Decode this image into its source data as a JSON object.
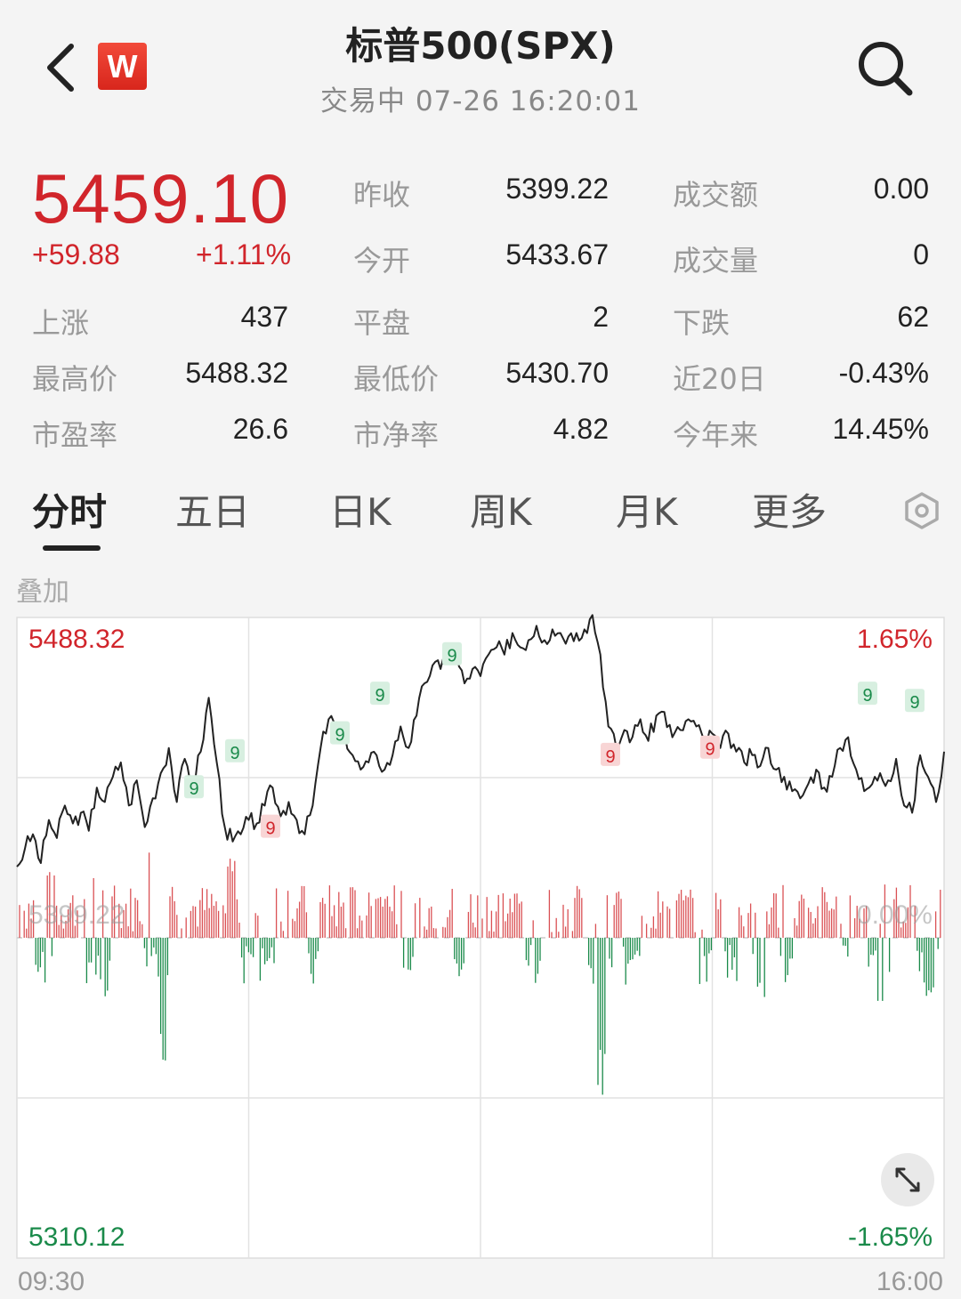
{
  "header": {
    "title": "标普500(SPX)",
    "status": "交易中 07-26 16:20:01",
    "logo_letter": "W",
    "back_icon": "chevron-left-icon",
    "search_icon": "search-icon"
  },
  "quote": {
    "price": "5459.10",
    "change": "+59.88",
    "change_pct": "+1.11%",
    "up_color": "#d1252b",
    "down_color": "#1a8a4a"
  },
  "stats": {
    "prev_close_label": "昨收",
    "prev_close": "5399.22",
    "open_label": "今开",
    "open": "5433.67",
    "turnover_label": "成交额",
    "turnover": "0.00",
    "volume_label": "成交量",
    "volume": "0",
    "advance_label": "上涨",
    "advance": "437",
    "flat_label": "平盘",
    "flat": "2",
    "decline_label": "下跌",
    "decline": "62",
    "high_label": "最高价",
    "high": "5488.32",
    "low_label": "最低价",
    "low": "5430.70",
    "d20_label": "近20日",
    "d20": "-0.43%",
    "pe_label": "市盈率",
    "pe": "26.6",
    "pb_label": "市净率",
    "pb": "4.82",
    "ytd_label": "今年来",
    "ytd": "14.45%"
  },
  "tabs": [
    "分时",
    "五日",
    "日K",
    "周K",
    "月K",
    "更多"
  ],
  "overlay_label": "叠加",
  "chart_labels": {
    "y_top": "5488.32",
    "y_mid": "5399.22",
    "y_bottom": "5310.12",
    "pct_top": "1.65%",
    "pct_mid": "0.00%",
    "pct_bottom": "-1.65%",
    "x_start": "09:30",
    "x_end": "16:00"
  },
  "chart_data": {
    "type": "line",
    "ylim": [
      5310.12,
      5488.32
    ],
    "baseline": 5399.22,
    "x": [
      "09:30",
      "16:00"
    ],
    "series": [
      {
        "values": [
          5419,
          5424,
          5428,
          5420,
          5432,
          5427,
          5436,
          5431,
          5434,
          5429,
          5441,
          5437,
          5444,
          5448,
          5436,
          5443,
          5430,
          5438,
          5445,
          5452,
          5437,
          5449,
          5442,
          5451,
          5466,
          5448,
          5430,
          5426,
          5428,
          5432,
          5431,
          5436,
          5441,
          5433,
          5437,
          5432,
          5428,
          5436,
          5452,
          5460,
          5458,
          5456,
          5450,
          5446,
          5448,
          5450,
          5446,
          5450,
          5458,
          5452,
          5461,
          5470,
          5475,
          5474,
          5480,
          5477,
          5470,
          5474,
          5472,
          5478,
          5480,
          5478,
          5484,
          5480,
          5482,
          5486,
          5482,
          5485,
          5484,
          5483,
          5484,
          5485,
          5489,
          5478,
          5458,
          5452,
          5457,
          5455,
          5460,
          5454,
          5461,
          5462,
          5455,
          5457,
          5460,
          5458,
          5454,
          5456,
          5452,
          5456,
          5451,
          5448,
          5450,
          5447,
          5452,
          5446,
          5444,
          5440,
          5438,
          5442,
          5446,
          5441,
          5444,
          5452,
          5455,
          5446,
          5440,
          5442,
          5445,
          5443,
          5449,
          5436,
          5434,
          5450,
          5444,
          5437,
          5451
        ],
        "markers_green": [
          [
            10,
            5439
          ],
          [
            12,
            5446
          ],
          [
            18,
            5460
          ],
          [
            21,
            5479
          ],
          [
            26,
            5494
          ],
          [
            47,
            5472
          ],
          [
            51,
            5476
          ]
        ],
        "markers_red": [
          [
            15,
            5430
          ],
          [
            35,
            5450
          ],
          [
            42,
            5448
          ]
        ]
      }
    ],
    "volume_bars": "red above / green below 5399.22 baseline"
  }
}
